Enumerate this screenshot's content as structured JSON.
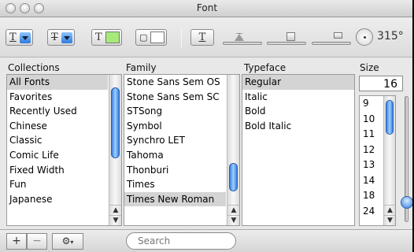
{
  "window": {
    "title": "Font"
  },
  "toolbar": {
    "underline_glyph": "T",
    "strikethrough_glyph": "T",
    "text_color_glyph": "T",
    "text_color": "#a6ea7a",
    "doc_color": "#ffffff",
    "shadow_glyph": "T",
    "angle": "315°"
  },
  "columns": {
    "collections_header": "Collections",
    "family_header": "Family",
    "typeface_header": "Typeface",
    "size_header": "Size"
  },
  "collections": [
    "All Fonts",
    "Favorites",
    "Recently Used",
    "Chinese",
    "Classic",
    "Comic Life",
    "Fixed Width",
    "Fun",
    "Japanese"
  ],
  "families": [
    "Stone Sans Sem OS",
    "Stone Sans Sem SC",
    "STSong",
    "Symbol",
    "Synchro LET",
    "Tahoma",
    "Thonburi",
    "Times",
    "Times New Roman"
  ],
  "typefaces": [
    "Regular",
    "Italic",
    "Bold",
    "Bold Italic"
  ],
  "size": {
    "value": "16",
    "options": [
      "9",
      "10",
      "11",
      "12",
      "13",
      "14",
      "18",
      "24"
    ]
  },
  "bottom": {
    "add": "+",
    "remove": "−",
    "search_placeholder": "Search"
  },
  "colors": {
    "selection": "#d4d4d4",
    "accent": "#3a7ee0"
  }
}
